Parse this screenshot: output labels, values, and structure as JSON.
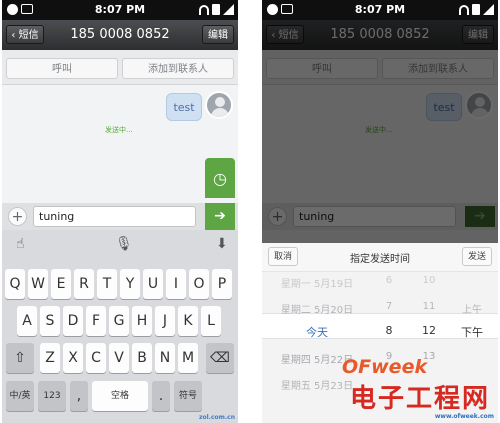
{
  "status_bar": {
    "time": "8:07 PM"
  },
  "title_bar": {
    "back_label": "‹ 短信",
    "title": "185 0008 0852",
    "edit_label": "编辑"
  },
  "actions": {
    "call_label": "呼叫",
    "add_contact_label": "添加到联系人"
  },
  "conversation": {
    "message_text": "test",
    "status_text": "发送中..."
  },
  "composer": {
    "text_value": "tuning",
    "plus_icon": "+",
    "send_icon": "➔",
    "schedule_icon": "◷"
  },
  "keyboard": {
    "tool_icons": [
      "hand-icon",
      "microphone-icon",
      "hide-keyboard-icon"
    ],
    "row1": [
      "Q",
      "W",
      "E",
      "R",
      "T",
      "Y",
      "U",
      "I",
      "O",
      "P"
    ],
    "row2": [
      "A",
      "S",
      "D",
      "F",
      "G",
      "H",
      "J",
      "K",
      "L"
    ],
    "row3": [
      "Z",
      "X",
      "C",
      "V",
      "B",
      "N",
      "M"
    ],
    "shift_glyph": "⇧",
    "backspace_glyph": "⌫",
    "lang_label": "中/英",
    "num_label": "123",
    "comma_label": ",",
    "space_label": "空格",
    "period_label": ".",
    "symbol_label": "符号"
  },
  "schedule_picker": {
    "cancel_label": "取消",
    "title": "指定发送时间",
    "send_label": "发送",
    "dates": [
      "星期一 5月19日",
      "星期二 5月20日",
      "今天",
      "星期四 5月22日",
      "星期五 5月23日"
    ],
    "hours": [
      "6",
      "7",
      "8",
      "9"
    ],
    "minutes": [
      "10",
      "11",
      "12",
      "13"
    ],
    "periods": [
      "上午",
      "下午"
    ]
  },
  "watermarks": {
    "zol": "zol.com.cn",
    "ofweek": "OFweek",
    "cn_site": "电子工程网",
    "cn_url": "www.ofweek.com"
  }
}
